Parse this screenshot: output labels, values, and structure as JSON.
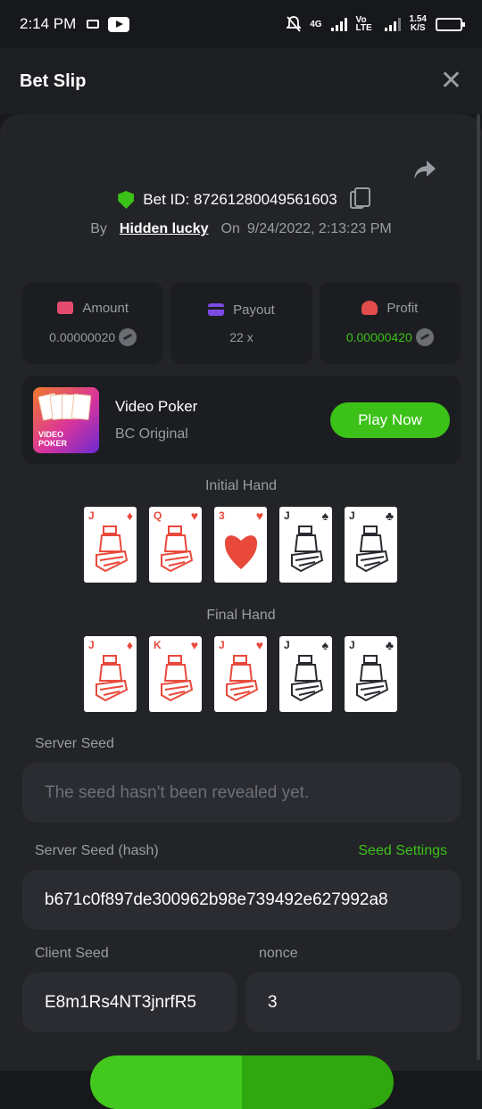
{
  "status_bar": {
    "time": "2:14 PM",
    "network": "4G",
    "volte": "Vo LTE",
    "speed_value": "1.54",
    "speed_unit": "K/S"
  },
  "header": {
    "title": "Bet Slip"
  },
  "bet": {
    "id_label": "Bet ID: 87261280049561603",
    "by_label": "By",
    "user": "Hidden lucky",
    "on_label": "On",
    "date": "9/24/2022, 2:13:23 PM"
  },
  "stats": [
    {
      "label": "Amount",
      "value": "0.00000020"
    },
    {
      "label": "Payout",
      "value": "22 x"
    },
    {
      "label": "Profit",
      "value": "0.00000420"
    }
  ],
  "game": {
    "name": "Video Poker",
    "subtitle": "BC Original",
    "thumb_text_1": "VIDEO",
    "thumb_text_2": "POKER",
    "play_label": "Play Now"
  },
  "initial_hand": {
    "label": "Initial Hand",
    "cards": [
      {
        "rank": "J",
        "suit": "♦",
        "color": "red"
      },
      {
        "rank": "Q",
        "suit": "♥",
        "color": "red"
      },
      {
        "rank": "3",
        "suit": "♥",
        "color": "red"
      },
      {
        "rank": "J",
        "suit": "♠",
        "color": "black"
      },
      {
        "rank": "J",
        "suit": "♣",
        "color": "black"
      }
    ]
  },
  "final_hand": {
    "label": "Final Hand",
    "cards": [
      {
        "rank": "J",
        "suit": "♦",
        "color": "red"
      },
      {
        "rank": "K",
        "suit": "♥",
        "color": "red"
      },
      {
        "rank": "J",
        "suit": "♥",
        "color": "red"
      },
      {
        "rank": "J",
        "suit": "♠",
        "color": "black"
      },
      {
        "rank": "J",
        "suit": "♣",
        "color": "black"
      }
    ]
  },
  "server_seed": {
    "label": "Server Seed",
    "placeholder": "The seed hasn't been revealed yet."
  },
  "server_seed_hash": {
    "label": "Server Seed (hash)",
    "link": "Seed Settings",
    "value": "b671c0f897de300962b98e739492e627992a8"
  },
  "client_seed": {
    "label": "Client Seed",
    "value": "E8m1Rs4NT3jnrfR5"
  },
  "nonce": {
    "label": "nonce",
    "value": "3"
  },
  "colors": {
    "accent": "#3bc117",
    "background": "#232428",
    "card_red": "#e8493b"
  }
}
